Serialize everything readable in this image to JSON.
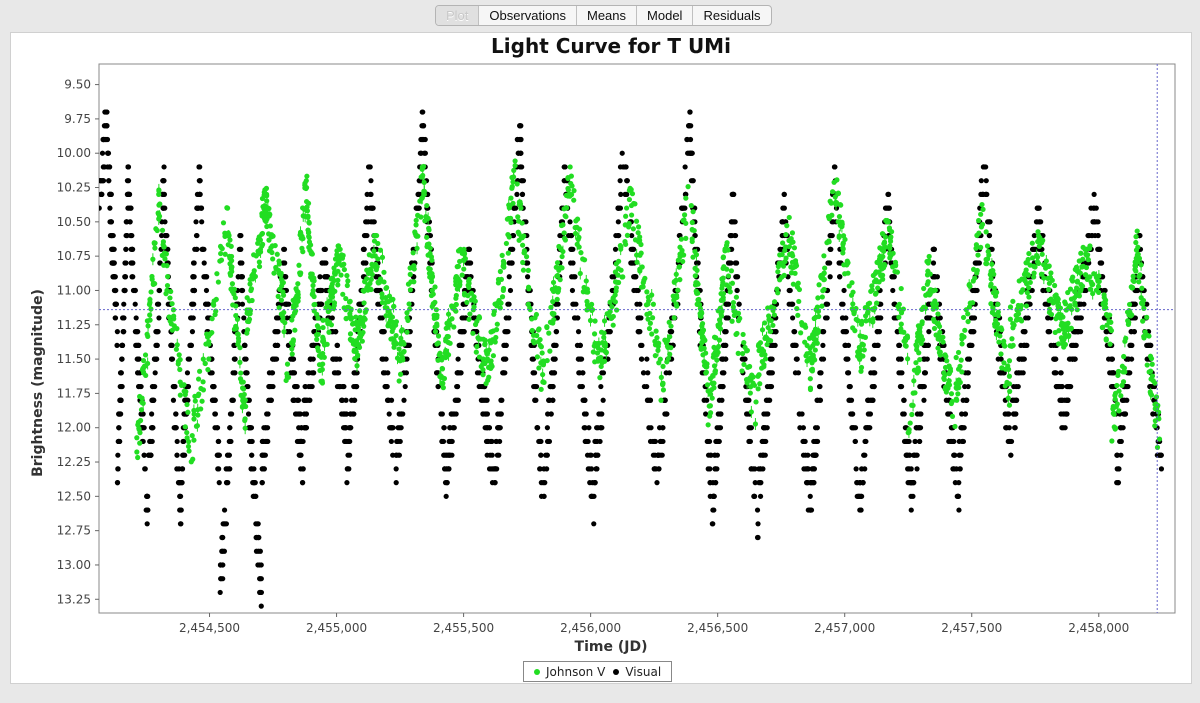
{
  "tabs": [
    {
      "label": "Plot",
      "selected": true
    },
    {
      "label": "Observations",
      "selected": false
    },
    {
      "label": "Means",
      "selected": false
    },
    {
      "label": "Model",
      "selected": false
    },
    {
      "label": "Residuals",
      "selected": false
    }
  ],
  "chart_data": {
    "type": "scatter",
    "title": "Light Curve for T UMi",
    "xlabel": "Time (JD)",
    "ylabel": "Brightness (magnitude)",
    "xlim": [
      2454065,
      2458300
    ],
    "ylim": [
      9.35,
      13.35
    ],
    "y_inverted": true,
    "x_ticks": [
      2454500,
      2455000,
      2455500,
      2456000,
      2456500,
      2457000,
      2457500,
      2458000
    ],
    "x_tick_labels": [
      "2,454,500",
      "2,455,000",
      "2,455,500",
      "2,456,000",
      "2,456,500",
      "2,457,000",
      "2,457,500",
      "2,458,000"
    ],
    "y_ticks": [
      9.5,
      9.75,
      10.0,
      10.25,
      10.5,
      10.75,
      11.0,
      11.25,
      11.5,
      11.75,
      12.0,
      12.25,
      12.5,
      12.75,
      13.0,
      13.25
    ],
    "y_tick_labels": [
      "9.50",
      "9.75",
      "10.00",
      "10.25",
      "10.50",
      "10.75",
      "11.00",
      "11.25",
      "11.50",
      "11.75",
      "12.00",
      "12.25",
      "12.50",
      "12.75",
      "13.00",
      "13.25"
    ],
    "crosshair": {
      "x": 2458230,
      "y": 11.14
    },
    "grid": false,
    "legend_position": "bottom-center",
    "series": [
      {
        "name": "Johnson V",
        "color": "#22dd22",
        "cycles": [
          {
            "center": 2454300,
            "max": 10.3,
            "min": 12.2
          },
          {
            "center": 2454570,
            "max": 10.4,
            "min": 12.0
          },
          {
            "center": 2454720,
            "max": 10.3,
            "min": 11.2
          },
          {
            "center": 2454880,
            "max": 10.2,
            "min": 11.7
          },
          {
            "center": 2455010,
            "max": 10.7,
            "min": 11.4
          },
          {
            "center": 2455150,
            "max": 10.6,
            "min": 11.4
          },
          {
            "center": 2455340,
            "max": 10.1,
            "min": 11.6
          },
          {
            "center": 2455490,
            "max": 10.7,
            "min": 11.6
          },
          {
            "center": 2455700,
            "max": 10.1,
            "min": 11.6
          },
          {
            "center": 2455920,
            "max": 10.1,
            "min": 11.6
          },
          {
            "center": 2456160,
            "max": 10.3,
            "min": 11.5
          },
          {
            "center": 2456390,
            "max": 10.2,
            "min": 11.7
          },
          {
            "center": 2456530,
            "max": 10.7,
            "min": 11.9
          },
          {
            "center": 2456780,
            "max": 10.5,
            "min": 11.6
          },
          {
            "center": 2456960,
            "max": 10.1,
            "min": 11.5
          },
          {
            "center": 2457170,
            "max": 10.5,
            "min": 11.4
          },
          {
            "center": 2457330,
            "max": 10.8,
            "min": 11.9
          },
          {
            "center": 2457540,
            "max": 10.4,
            "min": 11.7
          },
          {
            "center": 2457760,
            "max": 10.6,
            "min": 11.3
          },
          {
            "center": 2457950,
            "max": 10.7,
            "min": 11.3
          },
          {
            "center": 2458150,
            "max": 10.6,
            "min": 12.1
          }
        ]
      },
      {
        "name": "Visual",
        "color": "#000000",
        "cycles": [
          {
            "center": 2454095,
            "max": 9.7,
            "min": 11.3
          },
          {
            "center": 2454180,
            "max": 10.1,
            "min": 12.3
          },
          {
            "center": 2454320,
            "max": 10.1,
            "min": 12.7
          },
          {
            "center": 2454460,
            "max": 10.1,
            "min": 12.3
          },
          {
            "center": 2454620,
            "max": 10.6,
            "min": 13.2
          },
          {
            "center": 2454790,
            "max": 10.7,
            "min": 12.3
          },
          {
            "center": 2454950,
            "max": 10.7,
            "min": 12.0
          },
          {
            "center": 2455130,
            "max": 10.1,
            "min": 12.3
          },
          {
            "center": 2455340,
            "max": 9.7,
            "min": 12.3
          },
          {
            "center": 2455520,
            "max": 10.7,
            "min": 12.4
          },
          {
            "center": 2455720,
            "max": 9.7,
            "min": 12.4
          },
          {
            "center": 2455900,
            "max": 10.0,
            "min": 12.6
          },
          {
            "center": 2456130,
            "max": 9.9,
            "min": 12.3
          },
          {
            "center": 2456390,
            "max": 9.7,
            "min": 12.4
          },
          {
            "center": 2456560,
            "max": 10.3,
            "min": 12.7
          },
          {
            "center": 2456760,
            "max": 10.3,
            "min": 12.5
          },
          {
            "center": 2456960,
            "max": 10.1,
            "min": 12.6
          },
          {
            "center": 2457170,
            "max": 10.3,
            "min": 12.4
          },
          {
            "center": 2457350,
            "max": 10.7,
            "min": 12.5
          },
          {
            "center": 2457550,
            "max": 10.0,
            "min": 12.2
          },
          {
            "center": 2457760,
            "max": 10.4,
            "min": 12.0
          },
          {
            "center": 2457980,
            "max": 10.3,
            "min": 11.8
          },
          {
            "center": 2458160,
            "max": 10.6,
            "min": 12.3
          }
        ]
      }
    ]
  }
}
